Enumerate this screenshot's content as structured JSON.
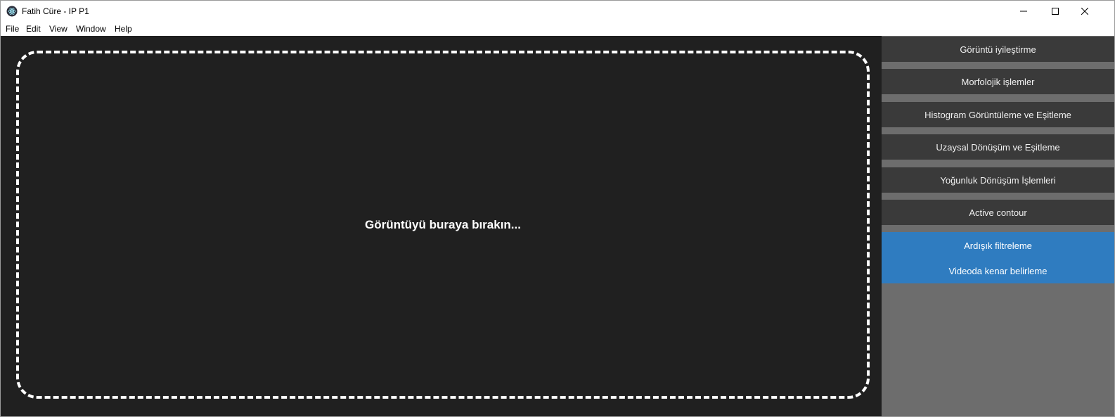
{
  "window": {
    "title": "Fatih Cüre - IP P1",
    "icon": "electron-app-icon"
  },
  "menu": [
    "File",
    "Edit",
    "View",
    "Window",
    "Help"
  ],
  "main": {
    "drop_text": "Görüntüyü buraya bırakın..."
  },
  "sidebar": {
    "items": [
      "Görüntü iyileştirme",
      "Morfolojik işlemler",
      "Histogram Görüntüleme ve Eşitleme",
      "Uzaysal Dönüşüm ve Eşitleme",
      "Yoğunluk Dönüşüm İşlemleri",
      "Active contour"
    ],
    "active_subitems": [
      "Ardışık filtreleme",
      "Videoda kenar belirleme"
    ]
  },
  "colors": {
    "content_bg": "#202020",
    "sidebar_bg": "#6d6d6d",
    "button_bg": "#3a3a3a",
    "accent": "#2f7cc0"
  }
}
